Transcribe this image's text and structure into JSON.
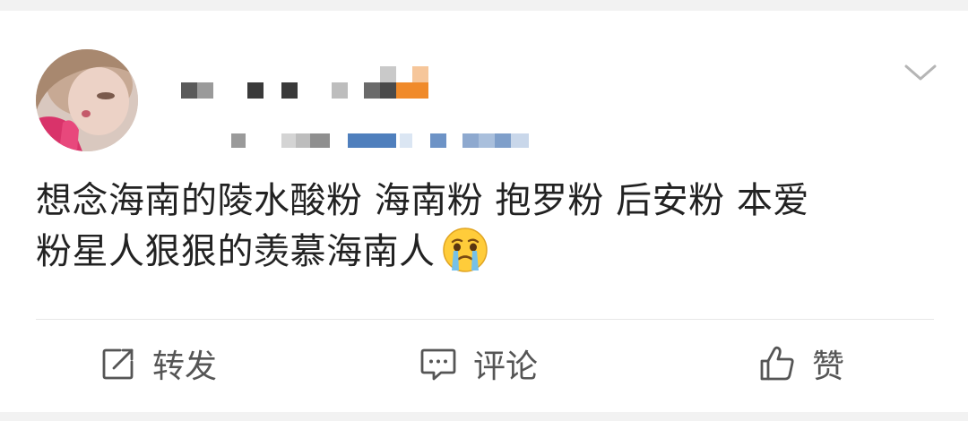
{
  "post": {
    "author": {
      "name_blurred": true,
      "meta_blurred": true
    },
    "content": {
      "line1": "想念海南的陵水酸粉 海南粉 抱罗粉 后安粉  本爱",
      "line2": "粉星人狠狠的羡慕海南人",
      "emoji": "crying-face"
    },
    "menu_icon": "chevron-down-icon"
  },
  "actions": {
    "repost_label": "转发",
    "comment_label": "评论",
    "like_label": "赞"
  },
  "colors": {
    "page_background": "#f2f2f2",
    "card_background": "#ffffff",
    "text": "#222222",
    "action_text": "#555555",
    "blur_orange": "#f08a2a",
    "blur_blue": "#4f7fbd"
  }
}
